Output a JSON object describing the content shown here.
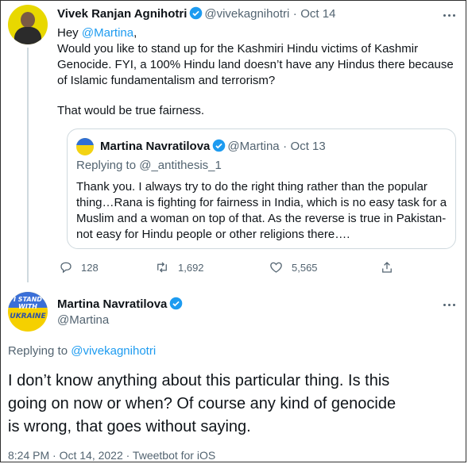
{
  "tweet1": {
    "author_name": "Vivek Ranjan Agnihotri",
    "handle": "@vivekagnihotri",
    "dot": "·",
    "date": "Oct 14",
    "lines": [
      "Hey ",
      " Would you like to stand up for the Kashmiri Hindu victims of  Kashmir",
      "Genocide. FYI, a 100% Hindu land doesn’t have any Hindus there because",
      "of Islamic fundamentalism and terrorism?",
      "That would be true fairness."
    ],
    "mention": "@Martina",
    "mention_suffix": ","
  },
  "quote": {
    "author_name": "Martina Navratilova",
    "handle": "@Martina",
    "dot": "·",
    "date": "Oct 13",
    "replying_prefix": "Replying to ",
    "replying_handle": "@_antithesis_1",
    "lines": [
      "Thank you. I always try to do the right thing rather than the popular",
      "thing…Rana is fighting for fairness in India, which is no easy task for a",
      "Muslim and a woman on top of that. As the reverse is true in Pakistan-",
      "not easy for Hindu people or other religions there…."
    ]
  },
  "actions": {
    "replies": "128",
    "retweets": "1,692",
    "likes": "5,565"
  },
  "tweet2": {
    "author_name": "Martina Navratilova",
    "handle": "@Martina",
    "avatar_text": [
      "I STAND",
      "WITH",
      "UKRAINE"
    ],
    "replying_prefix": "Replying to ",
    "replying_handle": "@vivekagnihotri",
    "lines": [
      "I don’t know anything about this particular thing. Is this",
      "going on now or when? Of course any kind of genocide",
      "is wrong, that goes without saying."
    ],
    "meta": "8:24 PM · Oct 14, 2022 · Tweetbot for iOS"
  },
  "colors": {
    "link": "#1d9bf0",
    "muted": "#536471",
    "text": "#0f1419"
  }
}
